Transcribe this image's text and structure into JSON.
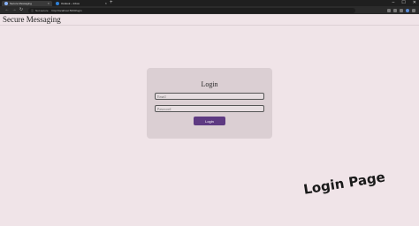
{
  "browser": {
    "tabs": [
      {
        "title": "Secure Messaging",
        "active": true
      },
      {
        "title": "Outlook – Inbox",
        "active": false
      }
    ],
    "address_info": "ⓘ",
    "address_status": "Not secure",
    "url": "http://localhost:5000/login",
    "new_tab": "+",
    "window_controls": [
      "–",
      "☐",
      "✕"
    ],
    "nav": {
      "back": "←",
      "forward": "→",
      "reload": "↻"
    }
  },
  "app": {
    "title": "Secure Messaging"
  },
  "login": {
    "heading": "Login",
    "email_placeholder": "Email",
    "password_placeholder": "Password",
    "submit_label": "Login"
  },
  "annotation": {
    "caption": "Login Page"
  },
  "colors": {
    "page_bg": "#f0e4e8",
    "card_bg": "#dbcfd3",
    "accent": "#5e3a82"
  }
}
